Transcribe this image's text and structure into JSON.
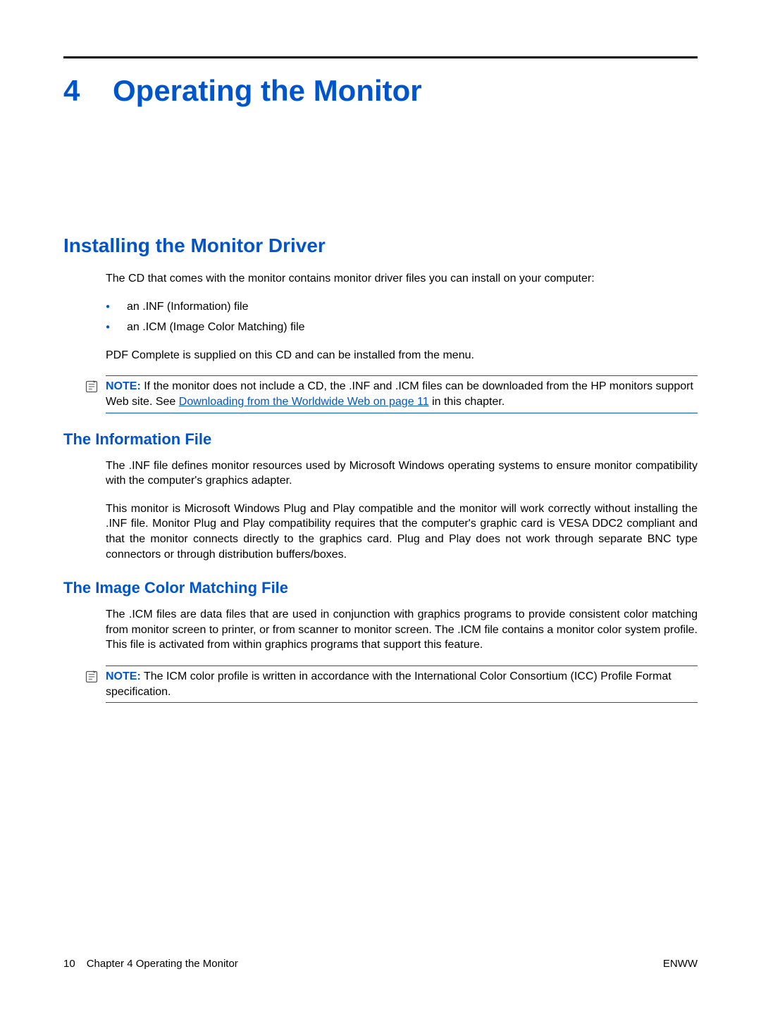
{
  "chapter": {
    "number": "4",
    "title": "Operating the Monitor"
  },
  "section1": {
    "heading": "Installing the Monitor Driver",
    "intro": "The CD that comes with the monitor contains monitor driver files you can install on your computer:",
    "bullets": [
      "an .INF (Information) file",
      "an .ICM (Image Color Matching) file"
    ],
    "afterBullets": "PDF Complete is supplied on this CD and can be installed from the menu.",
    "note": {
      "label": "NOTE:",
      "before": "If the monitor does not include a CD, the .INF and .ICM files can be downloaded from the HP monitors support Web site. See ",
      "link": "Downloading from the Worldwide Web on page 11",
      "after": " in this chapter."
    }
  },
  "section2": {
    "heading": "The Information File",
    "p1": "The .INF file defines monitor resources used by Microsoft Windows operating systems to ensure monitor compatibility with the computer's graphics adapter.",
    "p2": "This monitor is Microsoft Windows Plug and Play compatible and the monitor will work correctly without installing the .INF file. Monitor Plug and Play compatibility requires that the computer's graphic card is VESA DDC2 compliant and that the monitor connects directly to the graphics card. Plug and Play does not work through separate BNC type connectors or through distribution buffers/boxes."
  },
  "section3": {
    "heading": "The Image Color Matching File",
    "p1": "The .ICM files are data files that are used in conjunction with graphics programs to provide consistent color matching from monitor screen to printer, or from scanner to monitor screen. The .ICM file contains a monitor color system profile. This file is activated from within graphics programs that support this feature.",
    "note": {
      "label": "NOTE:",
      "text": "The ICM color profile is written in accordance with the International Color Consortium (ICC) Profile Format specification."
    }
  },
  "footer": {
    "pageNumber": "10",
    "chapterRef": "Chapter 4   Operating the Monitor",
    "right": "ENWW"
  }
}
